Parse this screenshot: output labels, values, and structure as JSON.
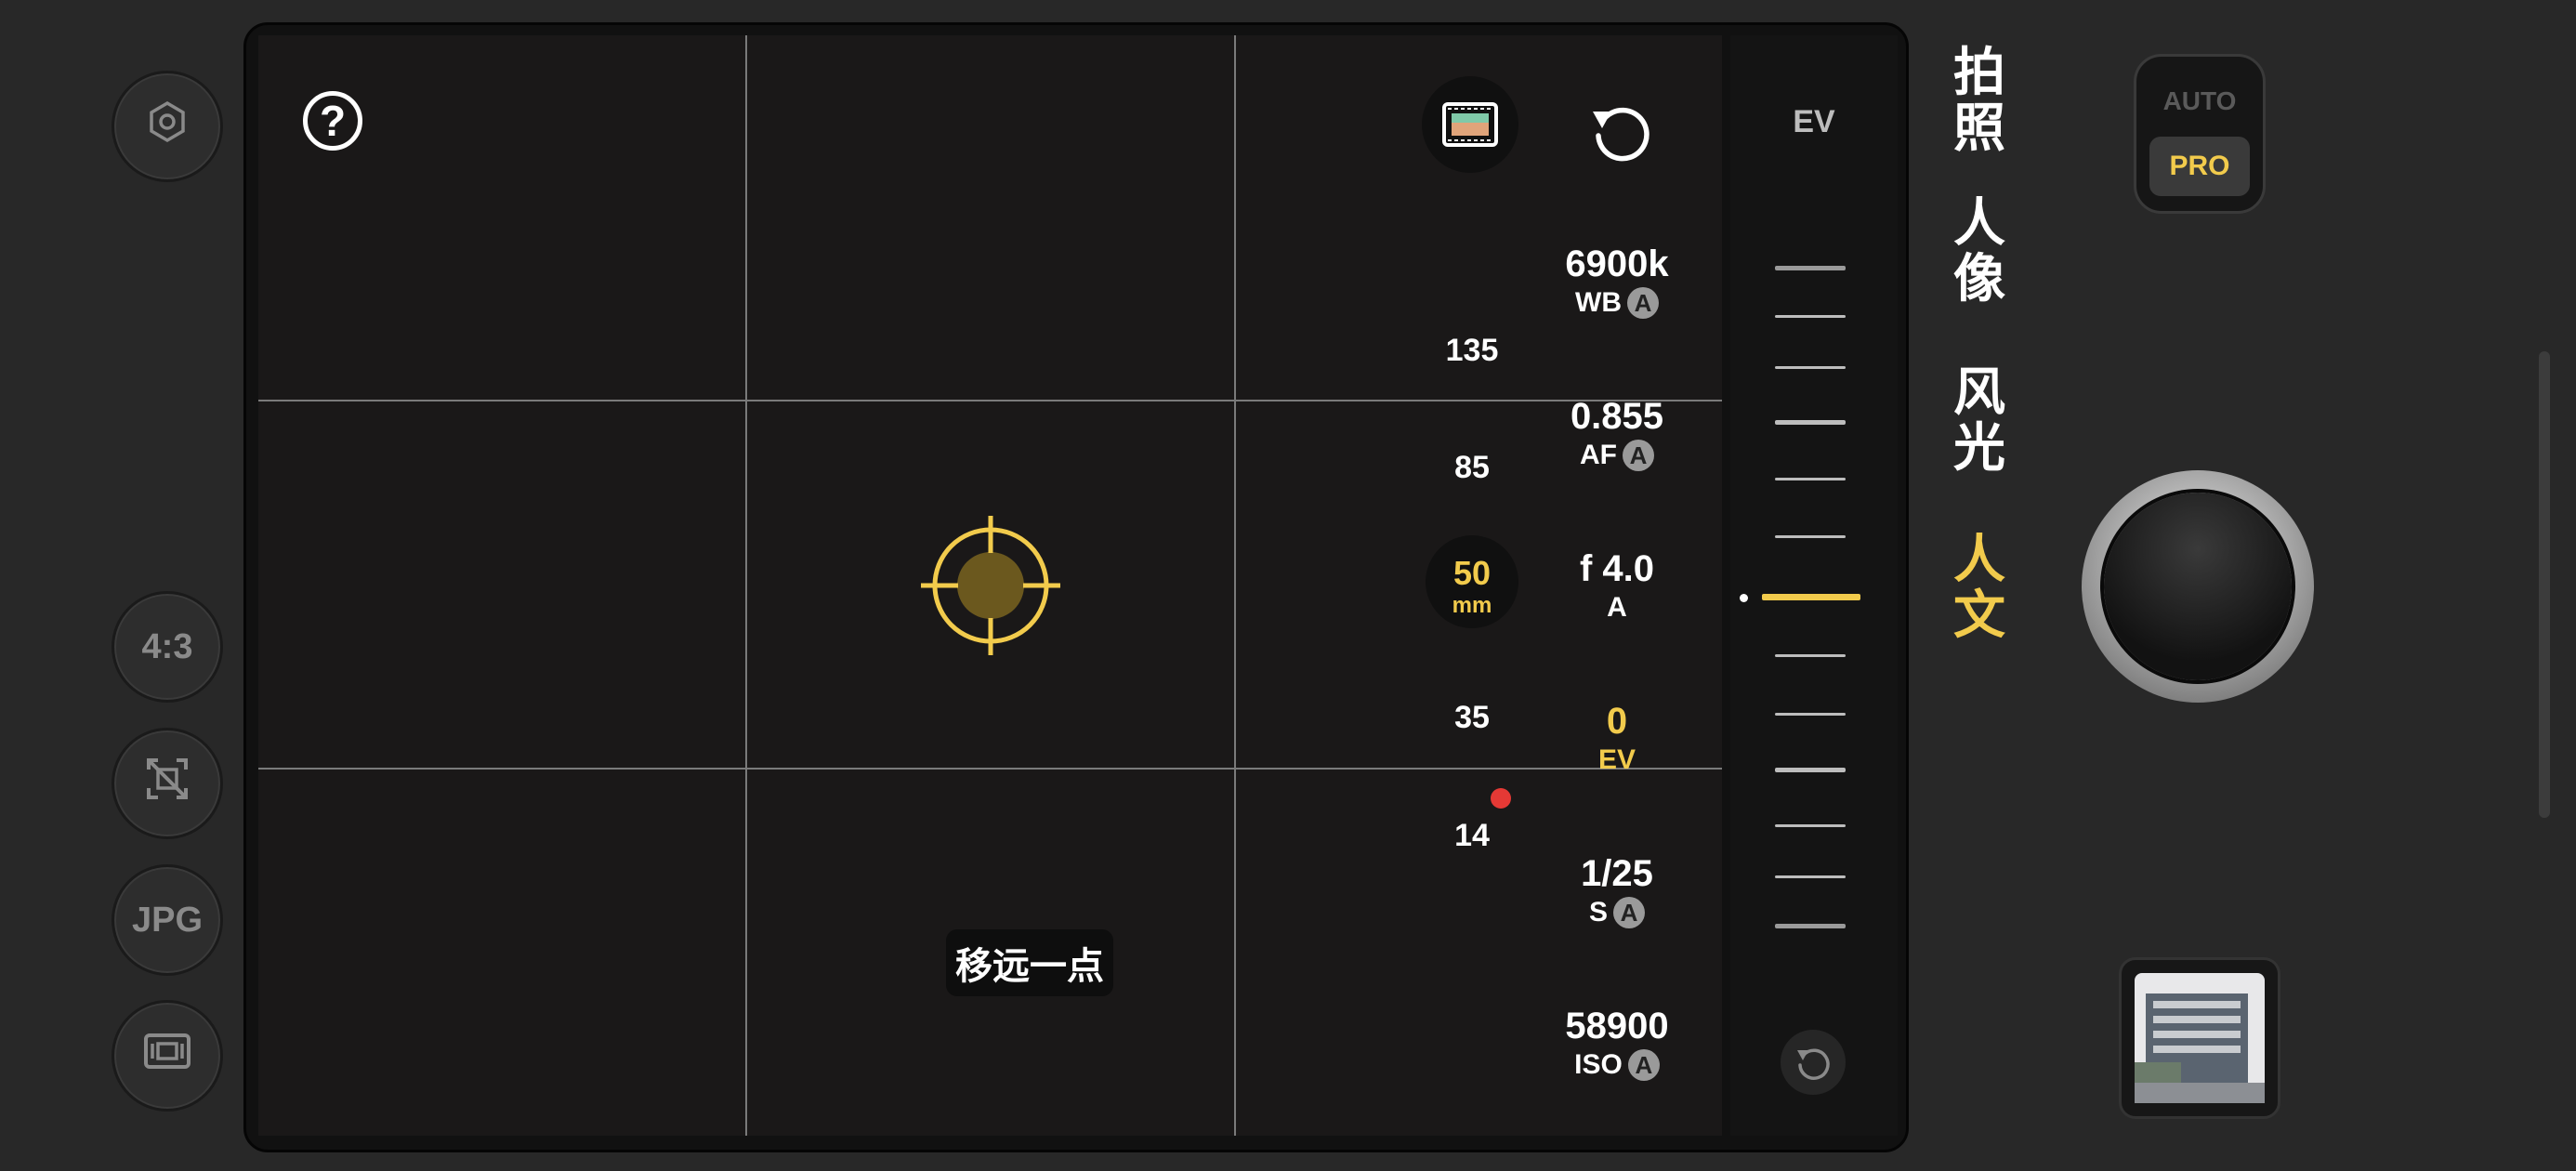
{
  "left_bar": {
    "aspect_label": "4:3",
    "format_label": "JPG"
  },
  "viewfinder": {
    "help_label": "?",
    "hint_text": "移远一点"
  },
  "focal_lengths": [
    {
      "label": "135"
    },
    {
      "label": "85"
    },
    {
      "label": "50",
      "unit": "mm"
    },
    {
      "label": "35"
    },
    {
      "label": "14"
    }
  ],
  "params": {
    "wb": {
      "value": "6900k",
      "label": "WB",
      "badge": "A"
    },
    "af": {
      "value": "0.855",
      "label": "AF",
      "badge": "A"
    },
    "aperture": {
      "value": "f 4.0",
      "label": "A"
    },
    "ev": {
      "value": "0",
      "label": "EV"
    },
    "shutter": {
      "value": "1/25",
      "label": "S",
      "badge": "A"
    },
    "iso": {
      "value": "58900",
      "label": "ISO",
      "badge": "A"
    }
  },
  "ev_strip": {
    "title": "EV"
  },
  "modes": {
    "photo": "拍照",
    "portrait": "人像",
    "landscape": "风光",
    "humanities": "人文",
    "active": "人文"
  },
  "auto_pro": {
    "auto": "AUTO",
    "pro": "PRO"
  },
  "colors": {
    "accent": "#f2cb4c",
    "record_dot": "#e53935"
  }
}
